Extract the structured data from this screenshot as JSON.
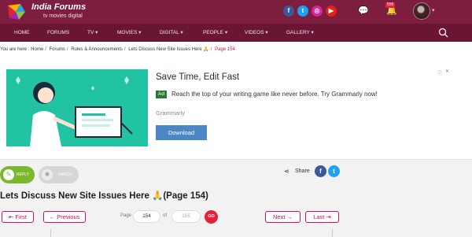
{
  "header": {
    "brand_name": "India Forums",
    "brand_tagline": "tv  movies  digital",
    "notification_count": "556",
    "social": [
      {
        "name": "facebook",
        "glyph": "f",
        "color": "#3b5998"
      },
      {
        "name": "twitter",
        "glyph": "t",
        "color": "#1da1f2"
      },
      {
        "name": "instagram",
        "glyph": "◎",
        "color": "#d6249f"
      },
      {
        "name": "youtube",
        "glyph": "▶",
        "color": "#e62117"
      }
    ]
  },
  "nav": {
    "items": [
      {
        "label": "HOME"
      },
      {
        "label": "FORUMS"
      },
      {
        "label": "TV ▾"
      },
      {
        "label": "MOVIES ▾"
      },
      {
        "label": "DIGITAL ▾"
      },
      {
        "label": "PEOPLE ▾"
      },
      {
        "label": "VIDEOS ▾"
      },
      {
        "label": "GALLERY ▾"
      }
    ]
  },
  "breadcrumb": {
    "prefix": "You are here :",
    "items": [
      "Home",
      "Forums",
      "Rules & Announcements",
      "Lets Discuss New Site Issues Here 🙏"
    ],
    "current": "Page 154"
  },
  "ad": {
    "headline": "Save Time, Edit Fast",
    "badge": "Ad",
    "text": "Reach the top of your writing game like never before. Try Grammarly now!",
    "brand": "Grammarly",
    "button_label": "Download"
  },
  "actions": {
    "reply_label": "REPLY",
    "watch_label": "WATCH",
    "share_label": "Share"
  },
  "thread": {
    "title": "Lets Discuss New Site Issues Here 🙏(Page 154)"
  },
  "pagination": {
    "first_label": "First",
    "previous_label": "Previous",
    "page_label": "Page",
    "current_page": "154",
    "of_label": "of",
    "total_pages": "155",
    "go_label": "GO",
    "next_label": "Next",
    "last_label": "Last"
  }
}
